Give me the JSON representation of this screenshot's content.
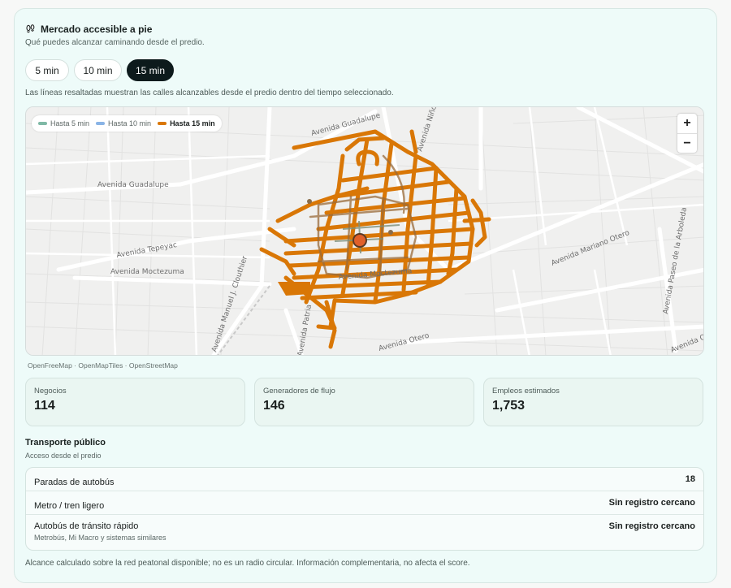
{
  "header": {
    "title": "Mercado accesible a pie",
    "subtitle": "Qué puedes alcanzar caminando desde el predio."
  },
  "tabs": [
    {
      "label": "5 min",
      "active": false
    },
    {
      "label": "10 min",
      "active": false
    },
    {
      "label": "15 min",
      "active": true
    }
  ],
  "description": "Las líneas resaltadas muestran las calles alcanzables desde el predio dentro del tiempo seleccionado.",
  "map": {
    "legend": [
      {
        "label": "Hasta 5 min",
        "color": "#7fb9a6"
      },
      {
        "label": "Hasta 10 min",
        "color": "#8ab4e6"
      },
      {
        "label": "Hasta 15 min",
        "color": "#d97706"
      }
    ],
    "zoom_in": "+",
    "zoom_out": "−",
    "street_labels": [
      "Avenida Guadalupe",
      "Avenida Guadalupe",
      "Avenida Niño Obrero",
      "Avenida Tepeyac",
      "Avenida Moctezuma",
      "Avenida Manuel J. Clouthier",
      "Avenida Patria",
      "Avenida Moctezuma",
      "Avenida Mariano Otero",
      "Avenida Paseo de la Arboleda",
      "Avenida Otero",
      "Avenida Otero"
    ],
    "attribution": "OpenFreeMap · OpenMapTiles · OpenStreetMap",
    "route_color": "#d97706",
    "marker_color": "#e0602a"
  },
  "stats": [
    {
      "label": "Negocios",
      "value": "114"
    },
    {
      "label": "Generadores de flujo",
      "value": "146"
    },
    {
      "label": "Empleos estimados",
      "value": "1,753"
    }
  ],
  "transport": {
    "title": "Transporte público",
    "subtitle": "Acceso desde el predio",
    "rows": [
      {
        "label": "Paradas de autobús",
        "value": "18",
        "sub": ""
      },
      {
        "label": "Metro / tren ligero",
        "value": "Sin registro cercano",
        "sub": ""
      },
      {
        "label": "Autobús de tránsito rápido",
        "value": "Sin registro cercano",
        "sub": "Metrobús, Mi Macro y sistemas similares"
      }
    ]
  },
  "footer": "Alcance calculado sobre la red peatonal disponible; no es un radio circular. Información complementaria, no afecta el score."
}
